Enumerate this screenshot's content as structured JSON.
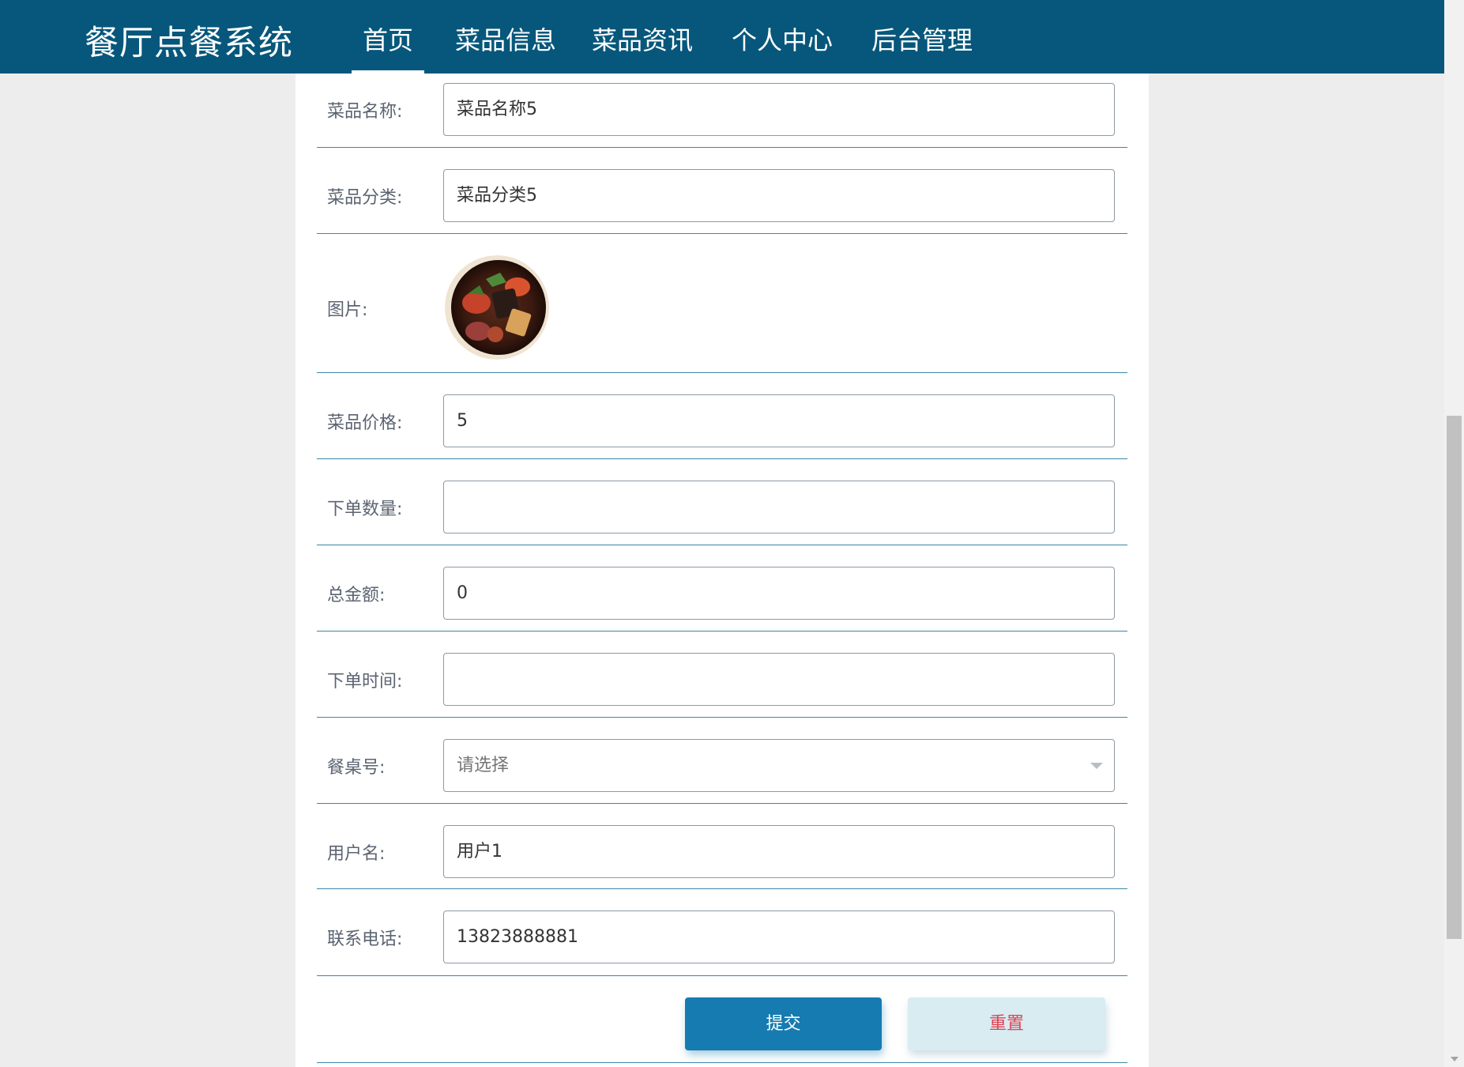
{
  "header": {
    "brand": "餐厅点餐系统",
    "nav": [
      {
        "label": "首页"
      },
      {
        "label": "菜品信息"
      },
      {
        "label": "菜品资讯"
      },
      {
        "label": "个人中心"
      },
      {
        "label": "后台管理"
      }
    ]
  },
  "form": {
    "dish_name": {
      "label": "菜品名称:",
      "value": "菜品名称5"
    },
    "dish_category": {
      "label": "菜品分类:",
      "value": "菜品分类5"
    },
    "image": {
      "label": "图片:"
    },
    "price": {
      "label": "菜品价格:",
      "value": "5"
    },
    "quantity": {
      "label": "下单数量:",
      "value": ""
    },
    "total": {
      "label": "总金额:",
      "value": "0"
    },
    "order_time": {
      "label": "下单时间:",
      "value": ""
    },
    "table_no": {
      "label": "餐桌号:",
      "placeholder": "请选择"
    },
    "username": {
      "label": "用户名:",
      "value": "用户1"
    },
    "phone": {
      "label": "联系电话:",
      "value": "13823888881"
    }
  },
  "actions": {
    "submit": "提交",
    "reset": "重置"
  },
  "colors": {
    "navbar": "#06577b",
    "primary_button": "#167bb1",
    "reset_button_bg": "#d8ecf2",
    "reset_button_text": "#e04454",
    "row_divider": "#3a87a8"
  }
}
